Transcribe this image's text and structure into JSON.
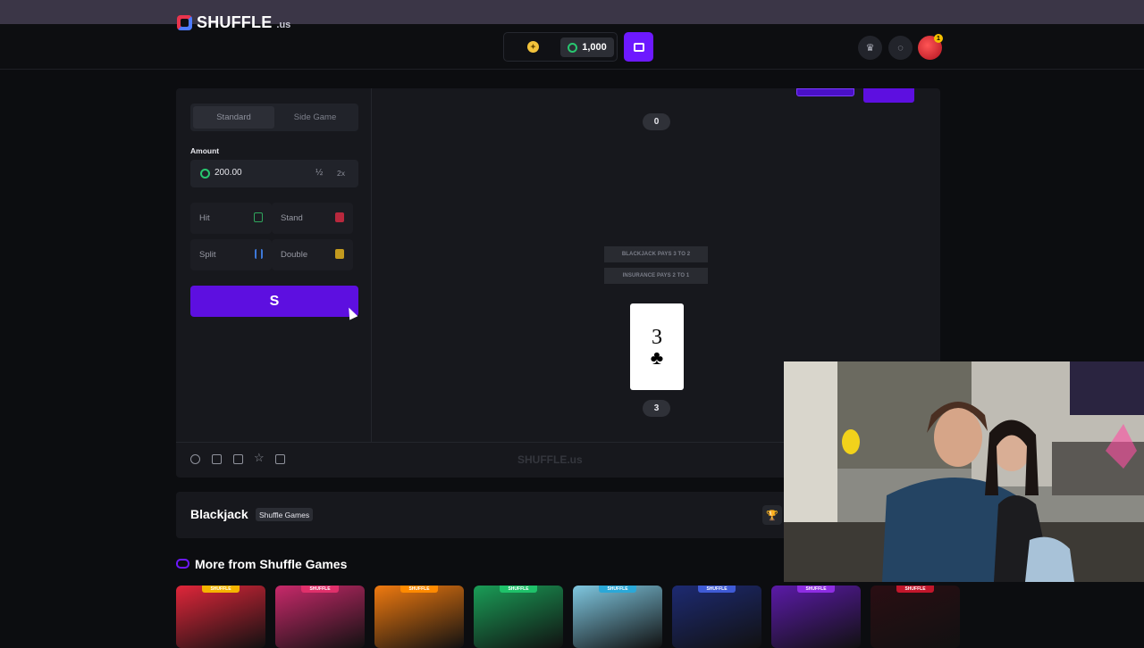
{
  "header": {
    "logo_text": "SHUFFLE",
    "logo_suffix": ".us",
    "balance": "1,000",
    "avatar_badge": "1"
  },
  "sidebar": {
    "mode_tabs": [
      "Standard",
      "Side Game"
    ],
    "amount_label": "Amount",
    "amount_value": "200.00",
    "half_label": "½",
    "double_label": "2x",
    "actions": {
      "hit": "Hit",
      "stand": "Stand",
      "split": "Split",
      "double": "Double"
    }
  },
  "table": {
    "dealer_score": "0",
    "ribbon_1": "BLACKJACK PAYS 3 TO 2",
    "ribbon_2": "INSURANCE PAYS 2 TO 1",
    "player_card_rank": "3",
    "player_card_suit": "♣",
    "player_score": "3",
    "watermark": "SHUFFLE.us"
  },
  "info": {
    "game_title": "Blackjack",
    "provider": "Shuffle Games"
  },
  "more_section": {
    "title": "More from Shuffle Games",
    "thumbnails": [
      {
        "tag": "SHUFFLE",
        "tag_color": "#f5b400",
        "bg": "#e0263a"
      },
      {
        "tag": "SHUFFLE",
        "tag_color": "#e0306b",
        "bg": "#c8296a"
      },
      {
        "tag": "SHUFFLE",
        "tag_color": "#ff8a00",
        "bg": "#f07a10"
      },
      {
        "tag": "SHUFFLE",
        "tag_color": "#1fc26a",
        "bg": "#1a9d57"
      },
      {
        "tag": "SHUFFLE",
        "tag_color": "#2aa8d8",
        "bg": "#7fc7e0"
      },
      {
        "tag": "SHUFFLE",
        "tag_color": "#3f5bd6",
        "bg": "#1d2a72"
      },
      {
        "tag": "SHUFFLE",
        "tag_color": "#8e2de2",
        "bg": "#5b1aa8"
      },
      {
        "tag": "SHUFFLE",
        "tag_color": "#c2162b",
        "bg": "#2a0e13"
      }
    ]
  },
  "colors": {
    "accent": "#6d19ff",
    "bet_button": "#5d0fe0",
    "panel": "#17181d",
    "background": "#0c0d10"
  }
}
